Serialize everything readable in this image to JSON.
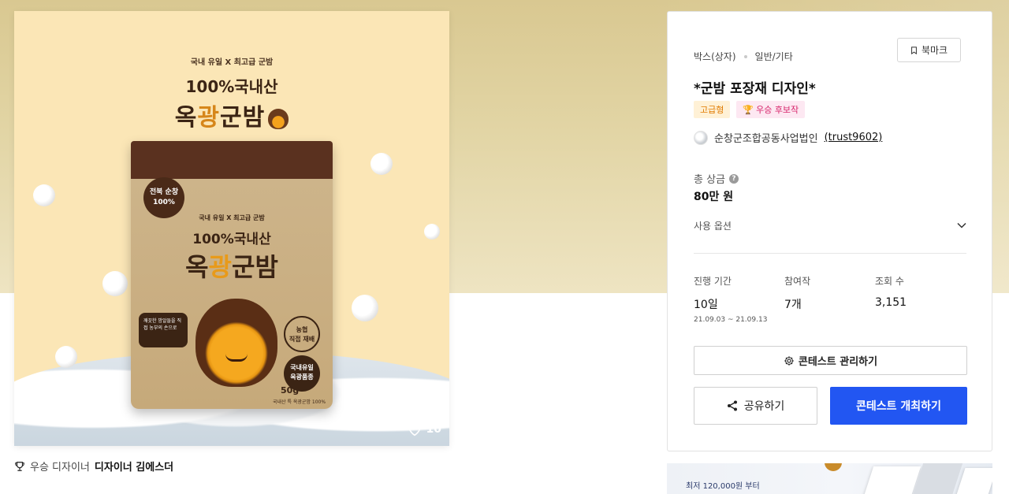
{
  "product_image": {
    "top_sub": "국내 유일 X 최고급 군밤",
    "headline": "100%국내산",
    "brand_left": "옥",
    "brand_mid": "광",
    "brand_right": "군밤",
    "pouch": {
      "badge_line1": "전북 순창",
      "badge_line2": "100%",
      "sub": "국내 유일 X 최고급 군밤",
      "headline": "100%국내산",
      "brand_left": "옥",
      "brand_mid": "광",
      "brand_right": "군밤",
      "bubble": "깨끗한 밤알들을 직접 농부의 손으로",
      "seal1_line1": "농협",
      "seal1_line2": "직접 재배",
      "seal2_line1": "국내유일",
      "seal2_line2": "옥광품종",
      "weight": "50g",
      "foot": "국내산 특 옥광군밤 100%"
    },
    "like_count": "10"
  },
  "designer": {
    "label": "우승 디자이너",
    "name": "디자이너 김에스더"
  },
  "panel": {
    "category": "박스(상자)",
    "subcategory": "일반/기타",
    "bookmark_label": "북마크",
    "title": "*군밤 포장재 디자인*",
    "badge_grade": "고급형",
    "badge_award": "우승 후보작",
    "holder_name": "순창군조합공동사업법인",
    "holder_id": "(trust9602)",
    "prize_label": "총 상금",
    "prize_value": "80만 원",
    "option_label": "사용 옵션",
    "stats": [
      {
        "label": "진행 기간",
        "value": "10일",
        "sub": "21.09.03 ~ 21.09.13"
      },
      {
        "label": "참여작",
        "value": "7개",
        "sub": ""
      },
      {
        "label": "조회 수",
        "value": "3,151",
        "sub": ""
      }
    ],
    "manage_label": "콘테스트 관리하기",
    "share_label": "공유하기",
    "host_label": "콘테스트 개최하기"
  },
  "ad": {
    "text": "최저 120,000원 부터"
  },
  "colors": {
    "primary": "#2256f2",
    "grade_badge": "#e07a00",
    "award_badge": "#d6246b"
  }
}
